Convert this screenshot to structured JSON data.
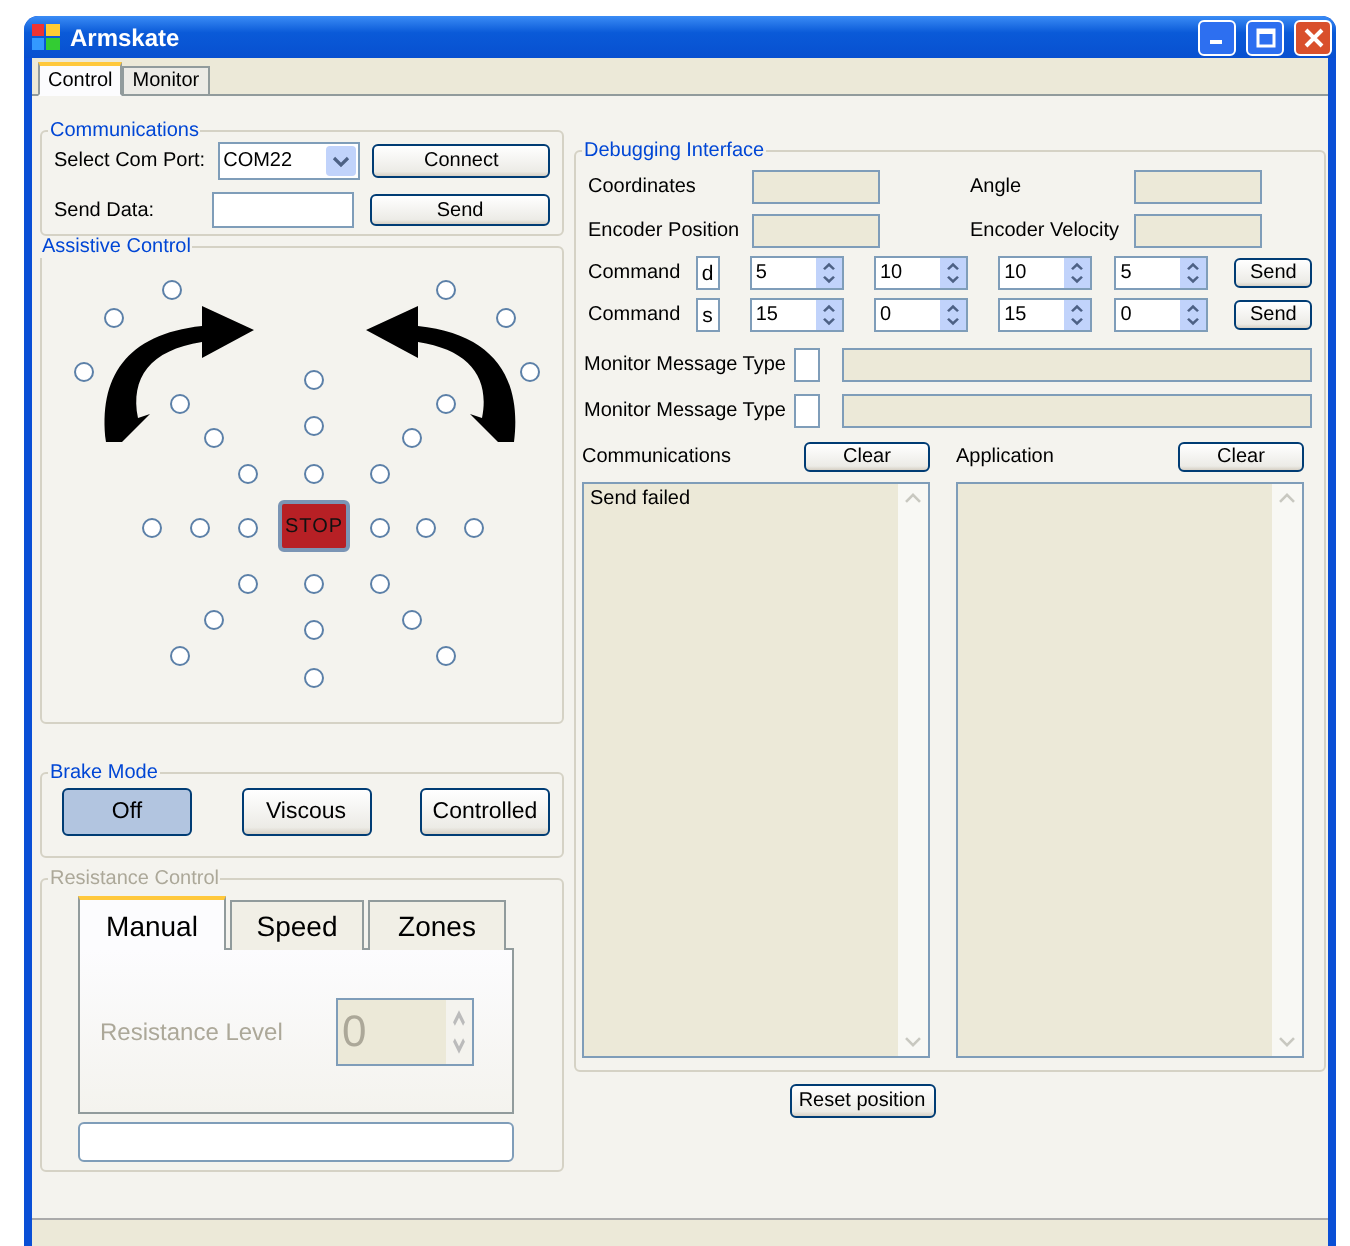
{
  "window": {
    "title": "Armskate"
  },
  "tabs": [
    {
      "label": "Control",
      "selected": true
    },
    {
      "label": "Monitor",
      "selected": false
    }
  ],
  "communications": {
    "title": "Communications",
    "port_label": "Select Com Port:",
    "port_value": "COM22",
    "connect_button": "Connect",
    "send_label": "Send Data:",
    "send_button": "Send"
  },
  "assistive_control": {
    "title": "Assistive Control",
    "stop_button": "STOP",
    "targets": [
      {
        "selected": false
      },
      {
        "selected": false
      },
      {
        "selected": false
      },
      {
        "selected": false
      },
      {
        "selected": false
      },
      {
        "selected": false
      },
      {
        "selected": false
      },
      {
        "selected": false
      },
      {
        "selected": false
      },
      {
        "selected": false
      },
      {
        "selected": false
      },
      {
        "selected": false
      },
      {
        "selected": false
      },
      {
        "selected": false
      },
      {
        "selected": false
      },
      {
        "selected": false
      },
      {
        "selected": false
      },
      {
        "selected": false
      },
      {
        "selected": false
      },
      {
        "selected": false
      },
      {
        "selected": false
      },
      {
        "selected": false
      },
      {
        "selected": false
      },
      {
        "selected": false
      },
      {
        "selected": false
      },
      {
        "selected": false
      },
      {
        "selected": false
      },
      {
        "selected": false
      },
      {
        "selected": false
      },
      {
        "selected": false
      }
    ]
  },
  "brake_mode": {
    "title": "Brake Mode",
    "options": [
      {
        "label": "Off",
        "selected": true
      },
      {
        "label": "Viscous",
        "selected": false
      },
      {
        "label": "Controlled",
        "selected": false
      }
    ]
  },
  "resistance_control": {
    "title": "Resistance Control",
    "disabled": true,
    "tabs": [
      {
        "label": "Manual",
        "selected": true
      },
      {
        "label": "Speed",
        "selected": false
      },
      {
        "label": "Zones",
        "selected": false
      }
    ],
    "level_label": "Resistance Level",
    "level_value": "0"
  },
  "debugging": {
    "title": "Debugging Interface",
    "readouts": [
      {
        "label": "Coordinates"
      },
      {
        "label": "Angle"
      },
      {
        "label": "Encoder Position"
      },
      {
        "label": "Encoder Velocity"
      }
    ],
    "commands": [
      {
        "label": "Command",
        "code": "d",
        "values": [
          "5",
          "10",
          "10",
          "5"
        ],
        "button": "Send"
      },
      {
        "label": "Command",
        "code": "s",
        "values": [
          "15",
          "0",
          "15",
          "0"
        ],
        "button": "Send"
      }
    ],
    "monitors": [
      {
        "label": "Monitor Message Type"
      },
      {
        "label": "Monitor Message Type"
      }
    ],
    "logs": [
      {
        "title": "Communications",
        "button": "Clear",
        "lines": [
          "Send failed"
        ]
      },
      {
        "title": "Application",
        "button": "Clear"
      }
    ]
  },
  "reset_button": "Reset position"
}
